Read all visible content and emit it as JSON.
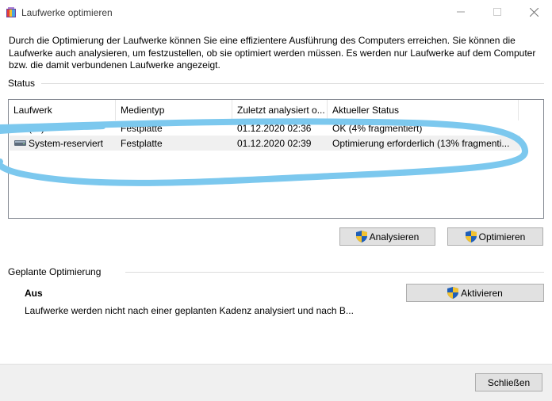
{
  "window": {
    "title": "Laufwerke optimieren"
  },
  "intro": {
    "text": "Durch die Optimierung der Laufwerke können Sie eine effizientere Ausführung des Computers erreichen. Sie können die Laufwerke auch analysieren, um festzustellen, ob sie optimiert werden müssen. Es werden nur Laufwerke auf dem Computer bzw. die damit verbundenen Laufwerke angezeigt."
  },
  "status": {
    "group_label": "Status",
    "columns": [
      "Laufwerk",
      "Medientyp",
      "Zuletzt analysiert o...",
      "Aktueller Status"
    ],
    "rows": [
      {
        "drive": "(C:)",
        "media": "Festplatte",
        "analyzed": "01.12.2020 02:36",
        "status": "OK (4% fragmentiert)"
      },
      {
        "drive": "System-reserviert",
        "media": "Festplatte",
        "analyzed": "01.12.2020 02:39",
        "status": "Optimierung erforderlich (13% fragmenti..."
      }
    ],
    "scribble_color": "#7cc8ee"
  },
  "buttons": {
    "analyze": "Analysieren",
    "optimize": "Optimieren",
    "activate": "Aktivieren",
    "close": "Schließen"
  },
  "schedule": {
    "group_label": "Geplante Optimierung",
    "state": "Aus",
    "description": "Laufwerke werden nicht nach einer geplanten Kadenz analysiert und nach B..."
  }
}
